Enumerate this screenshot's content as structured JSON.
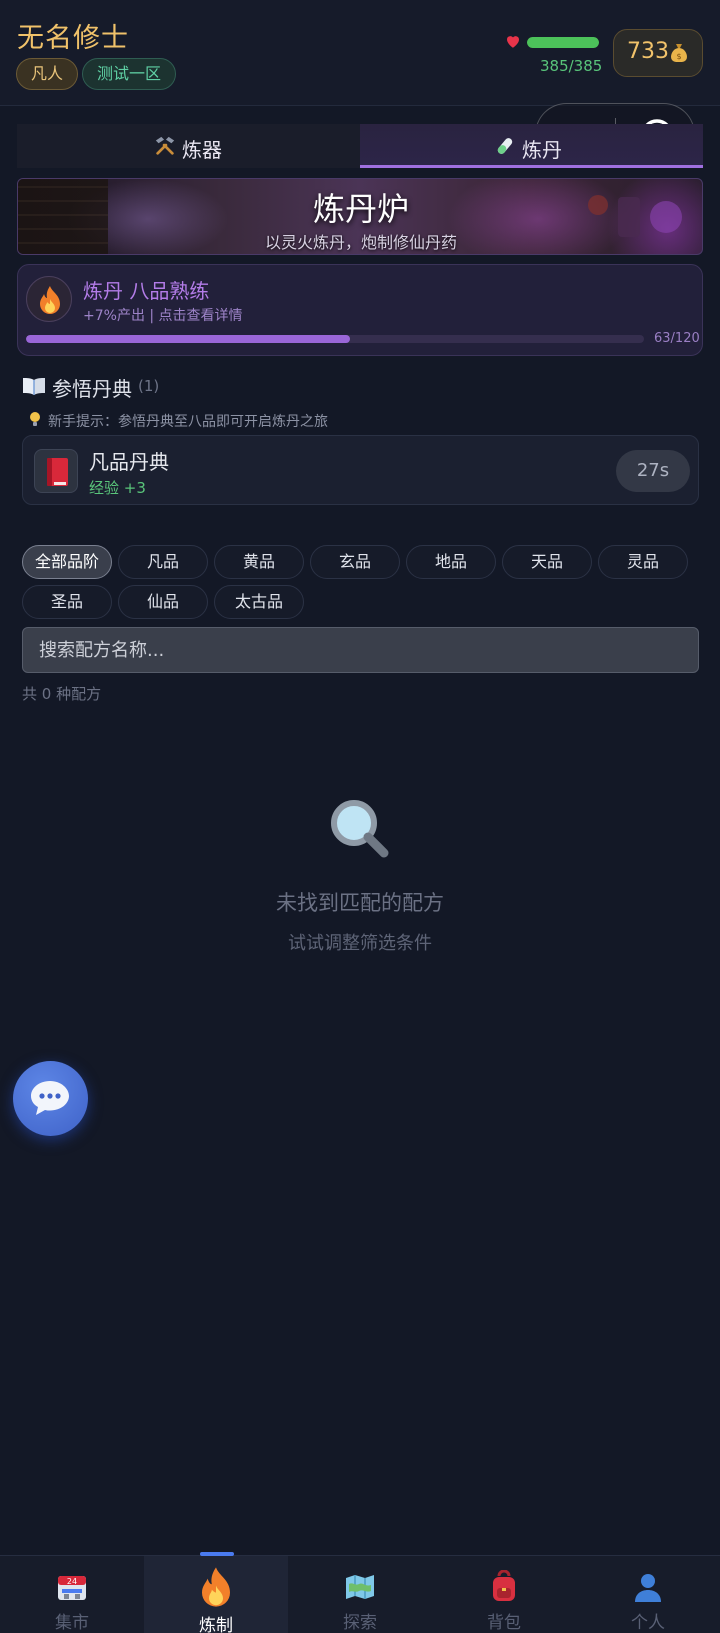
{
  "header": {
    "player_name": "无名修士",
    "realm_badge": "凡人",
    "server_badge": "测试一区",
    "hp": {
      "text": "385/385",
      "fraction": 1.0
    },
    "coins": "733"
  },
  "tabs": [
    {
      "label": "炼器",
      "icon": "hammer-pick-icon",
      "active": false
    },
    {
      "label": "炼丹",
      "icon": "test-tube-icon",
      "active": true
    }
  ],
  "banner": {
    "title": "炼丹炉",
    "subtitle": "以灵火炼丹，炮制修仙丹药"
  },
  "skill": {
    "title": "炼丹 八品熟练",
    "subtitle": "+7%产出 | 点击查看详情",
    "progress_text": "63/120",
    "progress_fraction": 0.525
  },
  "manuals": {
    "title": "参悟丹典",
    "count": "(1)",
    "tip": "新手提示：参悟丹典至八品即可开启炼丹之旅",
    "items": [
      {
        "name": "凡品丹典",
        "exp": "经验 +3",
        "timer": "27s"
      }
    ]
  },
  "filters": {
    "grades": [
      "全部品阶",
      "凡品",
      "黄品",
      "玄品",
      "地品",
      "天品",
      "灵品",
      "圣品",
      "仙品",
      "太古品"
    ],
    "active_index": 0
  },
  "search": {
    "placeholder": "搜索配方名称..."
  },
  "result_count": "共 0 种配方",
  "empty_state": {
    "title": "未找到匹配的配方",
    "subtitle": "试试调整筛选条件"
  },
  "bottom_nav": [
    {
      "label": "集市",
      "icon": "calendar-shop-icon",
      "active": false
    },
    {
      "label": "炼制",
      "icon": "fire-icon",
      "active": true
    },
    {
      "label": "探索",
      "icon": "map-icon",
      "active": false
    },
    {
      "label": "背包",
      "icon": "backpack-icon",
      "active": false
    },
    {
      "label": "个人",
      "icon": "person-icon",
      "active": false
    }
  ],
  "colors": {
    "accent_purple": "#a070e0",
    "gold": "#f0c26a",
    "green": "#59c47a",
    "nav_indicator": "#4a7bf0"
  }
}
